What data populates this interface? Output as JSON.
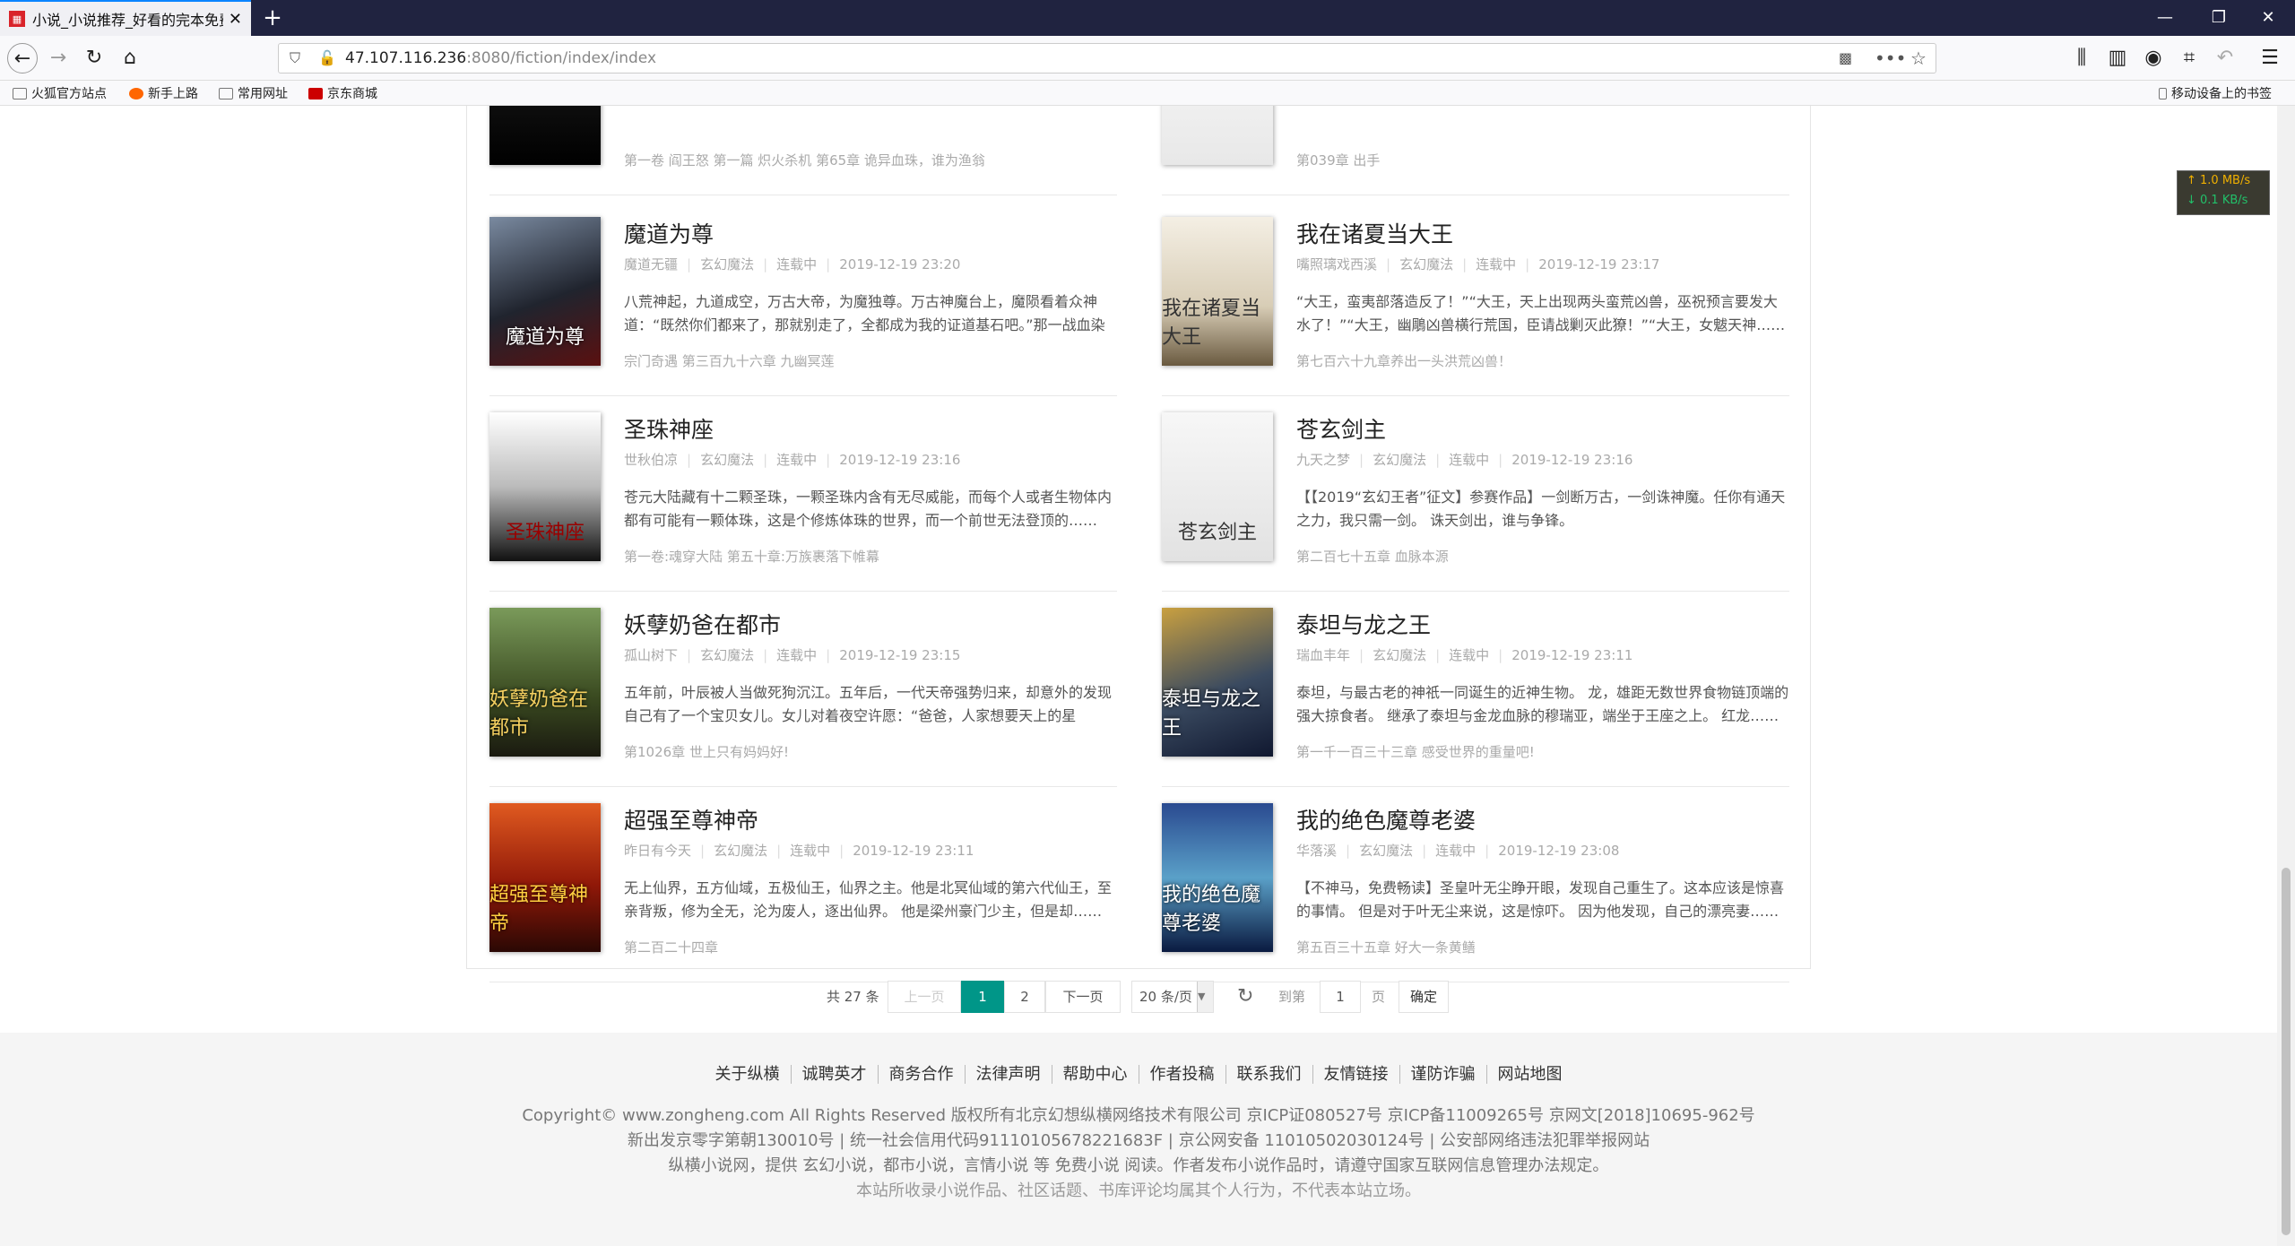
{
  "browser": {
    "tab_title": "小说_小说推荐_好看的完本免费",
    "url_host": "47.107.116.236",
    "url_rest": ":8080/fiction/index/index",
    "bookmarks": [
      "火狐官方站点",
      "新手上路",
      "常用网址",
      "京东商城"
    ],
    "mobile_bookmarks": "移动设备上的书签",
    "net_up": "↑ 1.0 MB/s",
    "net_down": "↓ 0.1 KB/s"
  },
  "partial_rows": [
    {
      "latest": "第一卷 阎王怒 第一篇 炽火杀机 第65章 诡异血珠，谁为渔翁"
    },
    {
      "latest": "第039章 出手"
    }
  ],
  "books": [
    {
      "title": "魔道为尊",
      "author": "魔道无疆",
      "category": "玄幻魔法",
      "status": "连载中",
      "time": "2019-12-19 23:20",
      "desc": "八荒神起，九道成空，万古大帝，为魔独尊。万古神魔台上，魔陨看着众神道：“既然你们都来了，那就别走了，全都成为我的证道基石吧。”那一战血染苍穹……",
      "latest": "宗门奇遇 第三百九十六章 九幽冥莲"
    },
    {
      "title": "我在诸夏当大王",
      "author": "嘴照璃戏西溪",
      "category": "玄幻魔法",
      "status": "连载中",
      "time": "2019-12-19 23:17",
      "desc": "“大王，蛮夷部落造反了！”“大王，天上出现两头蛮荒凶兽，巫祝预言要发大水了！”“大王，幽鵰凶兽横行荒国，臣请战剿灭此獠！”“大王，女魃天神……",
      "latest": "第七百六十九章养出一头洪荒凶兽！"
    },
    {
      "title": "圣珠神座",
      "author": "世秋伯凉",
      "category": "玄幻魔法",
      "status": "连载中",
      "time": "2019-12-19 23:16",
      "desc": "苍元大陆藏有十二颗圣珠，一颗圣珠内含有无尽威能，而每个人或者生物体内都有可能有一颗体珠，这是个修炼体珠的世界，而一个前世无法登顶的……",
      "latest": "第一卷:魂穿大陆 第五十章:万族裹落下帷幕"
    },
    {
      "title": "苍玄剑主",
      "author": "九天之梦",
      "category": "玄幻魔法",
      "status": "连载中",
      "time": "2019-12-19 23:16",
      "desc": "【【2019“玄幻王者”征文】参赛作品】一剑断万古，一剑诛神魔。任你有通天之力，我只需一剑。 诛天剑出，谁与争锋。",
      "latest": "第二百七十五章 血脉本源"
    },
    {
      "title": "妖孽奶爸在都市",
      "author": "孤山树下",
      "category": "玄幻魔法",
      "status": "连载中",
      "time": "2019-12-19 23:15",
      "desc": "五年前，叶辰被人当做死狗沉江。五年后，一代天帝强势归来，却意外的发现自己有了一个宝贝女儿。女儿对着夜空许愿：“爸爸，人家想要天上的星星……",
      "latest": "第1026章 世上只有妈妈好!"
    },
    {
      "title": "泰坦与龙之王",
      "author": "瑞血丰年",
      "category": "玄幻魔法",
      "status": "连载中",
      "time": "2019-12-19 23:11",
      "desc": "泰坦，与最古老的神祇一同诞生的近神生物。 龙，雄距无数世界食物链顶端的强大掠食者。 继承了泰坦与金龙血脉的穆瑞亚，端坐于王座之上。 红龙……",
      "latest": "第一千一百三十三章 感受世界的重量吧!"
    },
    {
      "title": "超强至尊神帝",
      "author": "昨日有今天",
      "category": "玄幻魔法",
      "status": "连载中",
      "time": "2019-12-19 23:11",
      "desc": "无上仙界，五方仙域，五极仙王，仙界之主。他是北冥仙域的第六代仙王，至亲背叛，修为全无，沦为废人，逐出仙界。 他是梁州豪门少主，但是却……",
      "latest": "第二百二十四章"
    },
    {
      "title": "我的绝色魔尊老婆",
      "author": "华落溪",
      "category": "玄幻魔法",
      "status": "连载中",
      "time": "2019-12-19 23:08",
      "desc": "【不神马，免费畅读】圣皇叶无尘睁开眼，发现自己重生了。这本应该是惊喜的事情。 但是对于叶无尘来说，这是惊吓。 因为他发现，自己的漂亮妻……",
      "latest": "第五百三十五章 好大一条黄鳝"
    }
  ],
  "pagination": {
    "total": "共 27 条",
    "prev": "上一页",
    "pages": [
      "1",
      "2"
    ],
    "next": "下一页",
    "size": "20 条/页",
    "goto_label": "到第",
    "goto_value": "1",
    "page_unit": "页",
    "confirm": "确定"
  },
  "footer": {
    "links": [
      "关于纵横",
      "诚聘英才",
      "商务合作",
      "法律声明",
      "帮助中心",
      "作者投稿",
      "联系我们",
      "友情链接",
      "谨防诈骗",
      "网站地图"
    ],
    "line1": "Copyright© www.zongheng.com All Rights Reserved 版权所有北京幻想纵横网络技术有限公司  京ICP证080527号   京ICP备11009265号   京网文[2018]10695-962号",
    "line2": "新出发京零字第朝130010号  | 统一社会信用代码91110105678221683F  |  京公网安备 11010502030124号  |  公安部网络违法犯罪举报网站",
    "line3": "纵横小说网，提供 玄幻小说，都市小说，言情小说 等 免费小说 阅读。作者发布小说作品时，请遵守国家互联网信息管理办法规定。",
    "line4": "本站所收录小说作品、社区话题、书库评论均属其个人行为，不代表本站立场。"
  },
  "colors": {
    "accent": "#009688",
    "chrome": "#202340"
  }
}
